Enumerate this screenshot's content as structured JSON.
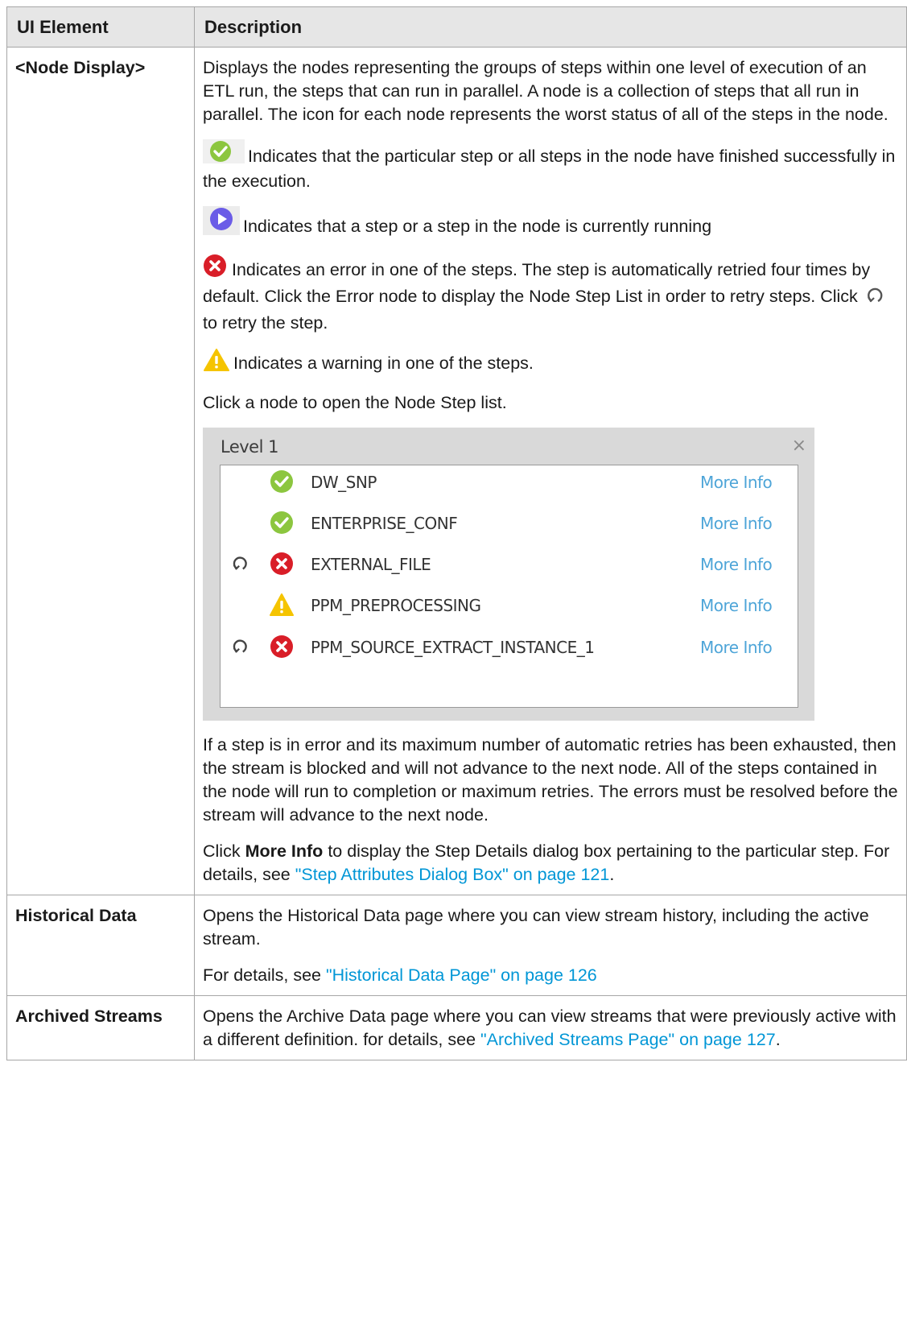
{
  "table": {
    "headers": [
      "UI Element",
      "Description"
    ],
    "node_display": {
      "name": "<Node Display>",
      "intro": "Displays the nodes representing the groups of steps within one level of execution of an ETL run, the steps that can run in parallel. A node is a collection of steps that all run in parallel. The icon for each node represents the worst status of all of the steps in the node.",
      "status_success": "Indicates that the particular step or all steps in the node have finished successfully in the execution.",
      "status_running": "Indicates that a step or a step in the node is currently running",
      "status_error_a": "Indicates an error in one of the steps. The step is automatically retried four times by default. Click the Error node to display the Node Step List in order to retry steps. Click",
      "status_error_b": "to retry the step.",
      "status_warning": "Indicates a warning in one of the steps.",
      "click_node": "Click a node to open the Node Step list.",
      "blocked": "If a step is in error and its maximum number of automatic retries has been exhausted, then the stream is blocked and will not advance to the next node. All of the steps contained in the node will run to completion or maximum retries. The errors must be resolved before the stream will advance to the next node.",
      "more_info_a": "Click",
      "more_info_bold": "More Info",
      "more_info_b": "to display the Step Details dialog box pertaining to the particular step. For details, see",
      "more_info_link": "\"Step Attributes Dialog Box\" on page 121",
      "more_info_end": "."
    },
    "historical": {
      "name": "Historical Data",
      "desc": "Opens the Historical Data page where you can view stream history, including the active stream.",
      "details": "For details, see",
      "link": "\"Historical Data Page\" on page 126"
    },
    "archived": {
      "name": "Archived Streams",
      "desc": "Opens the Archive Data page where you can view streams that were previously active with a different definition. for details, see",
      "link": "\"Archived Streams Page\" on page 127",
      "end": "."
    }
  },
  "panel": {
    "title": "Level 1",
    "close": "×",
    "more_label": "More Info",
    "rows": [
      {
        "name": "DW_SNP",
        "status": "success",
        "retry": false
      },
      {
        "name": "ENTERPRISE_CONF",
        "status": "success",
        "retry": false
      },
      {
        "name": "EXTERNAL_FILE",
        "status": "error",
        "retry": true
      },
      {
        "name": "PPM_PREPROCESSING",
        "status": "warning",
        "retry": false
      },
      {
        "name": "PPM_SOURCE_EXTRACT_INSTANCE_1",
        "status": "error",
        "retry": true
      }
    ]
  },
  "colors": {
    "success": "#8cc63f",
    "running": "#6b5ce7",
    "error": "#d91e28",
    "warning": "#f5c400",
    "link": "#0096d6"
  },
  "icons": [
    "check-circle-icon",
    "play-circle-icon",
    "error-x-circle-icon",
    "warning-triangle-icon",
    "retry-icon"
  ]
}
